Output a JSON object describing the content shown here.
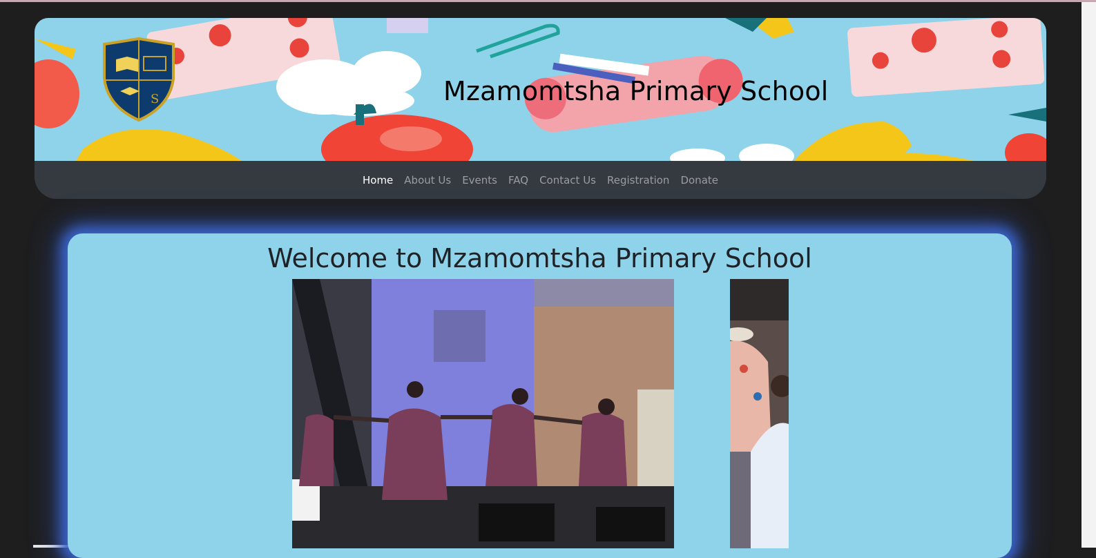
{
  "header": {
    "school_name": "Mzamomtsha Primary School",
    "crest_letter": "S",
    "colors": {
      "banner": "#8ed3ea",
      "navbar": "#343a40",
      "crest": "#0d3b6e",
      "crest_border": "#c9a227"
    }
  },
  "nav": {
    "items": [
      {
        "label": "Home",
        "active": true
      },
      {
        "label": "About Us",
        "active": false
      },
      {
        "label": "Events",
        "active": false
      },
      {
        "label": "FAQ",
        "active": false
      },
      {
        "label": "Contact Us",
        "active": false
      },
      {
        "label": "Registration",
        "active": false
      },
      {
        "label": "Donate",
        "active": false
      }
    ]
  },
  "main": {
    "welcome_title": "Welcome to Mzamomtsha Primary School",
    "photos": [
      {
        "name": "dancers-performance-photo"
      },
      {
        "name": "children-outdoor-photo"
      }
    ]
  }
}
